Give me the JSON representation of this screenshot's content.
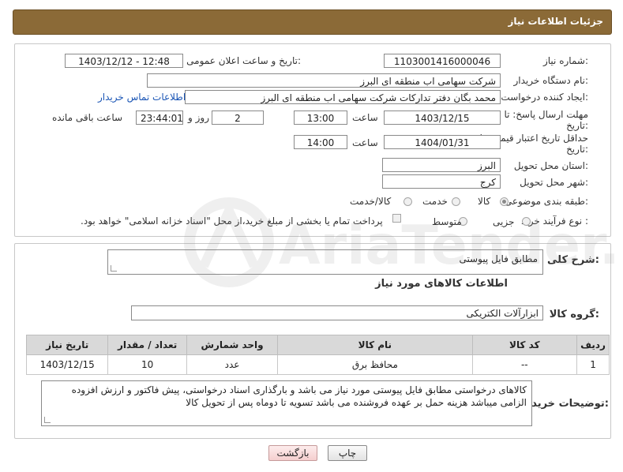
{
  "header": {
    "title": "جزئیات اطلاعات نیاز"
  },
  "form": {
    "need_number_label": "شماره نیاز:",
    "need_number": "1103001416000046",
    "announce_label": "تاریخ و ساعت اعلان عمومی:",
    "announce_value": "1403/12/12 - 12:48",
    "buyer_org_label": "نام دستگاه خریدار:",
    "buyer_org": "شرکت سهامی اب منطقه ای البرز",
    "creator_label": "ایجاد کننده درخواست:",
    "creator": "محمد بگان دفتر تدارکات شرکت سهامی اب منطقه ای البرز",
    "contact_link": "اطلاعات تماس خریدار",
    "deadline_label_1": "مهلت ارسال پاسخ: تا",
    "deadline_label_2": "تاریخ:",
    "deadline_date": "1403/12/15",
    "time_label": "ساعت",
    "deadline_time": "13:00",
    "days_value": "2",
    "days_label": "روز و",
    "remaining_time": "23:44:01",
    "remaining_label": "ساعت باقی مانده",
    "validity_label_1": "حداقل تاریخ اعتبار قیمت: تا",
    "validity_label_2": "تاریخ:",
    "validity_date": "1404/01/31",
    "validity_time": "14:00",
    "province_label": "استان محل تحویل:",
    "province": "البرز",
    "city_label": "شهر محل تحویل:",
    "city": "کرج",
    "category_label": "طبقه بندی موضوعی:",
    "category_options": [
      "کالا",
      "خدمت",
      "کالا/خدمت"
    ],
    "category_selected": "کالا",
    "process_label": "نوع فرآیند خرید :",
    "process_options": [
      "جزیی",
      "متوسط"
    ],
    "payment_note": "پرداخت تمام یا بخشی از مبلغ خرید،از محل \"اسناد خزانه اسلامی\" خواهد بود."
  },
  "details": {
    "description_label": "شرح کلی نیاز:",
    "description": "مطابق فایل پیوستی",
    "goods_info_title": "اطلاعات کالاهای مورد نیاز",
    "goods_group_label": "گروه کالا:",
    "goods_group": "ابزارآلات الکتریکی",
    "table": {
      "headers": [
        "ردیف",
        "کد کالا",
        "نام کالا",
        "واحد شمارش",
        "تعداد / مقدار",
        "تاریخ نیاز"
      ],
      "rows": [
        [
          "1",
          "--",
          "محافظ برق",
          "عدد",
          "10",
          "1403/12/15"
        ]
      ]
    },
    "buyer_notes_label": "توضیحات خریدار:",
    "buyer_notes": "کالاهای درخواستی مطابق فایل پیوستی مورد نیاز می باشد و بارگذاری اسناد درخواستی، پیش فاکتور و ارزش افزوده الزامی میباشد هزینه حمل بر عهده فروشنده می باشد تسویه تا دوماه پس از تحویل کالا"
  },
  "buttons": {
    "print": "چاپ",
    "back": "بازگشت"
  },
  "watermark": {
    "text": "AriaTender.neT"
  },
  "colors": {
    "title_bg": "#8b6a37",
    "link": "#1a55b5",
    "header_bg": "#d9d9d9"
  }
}
